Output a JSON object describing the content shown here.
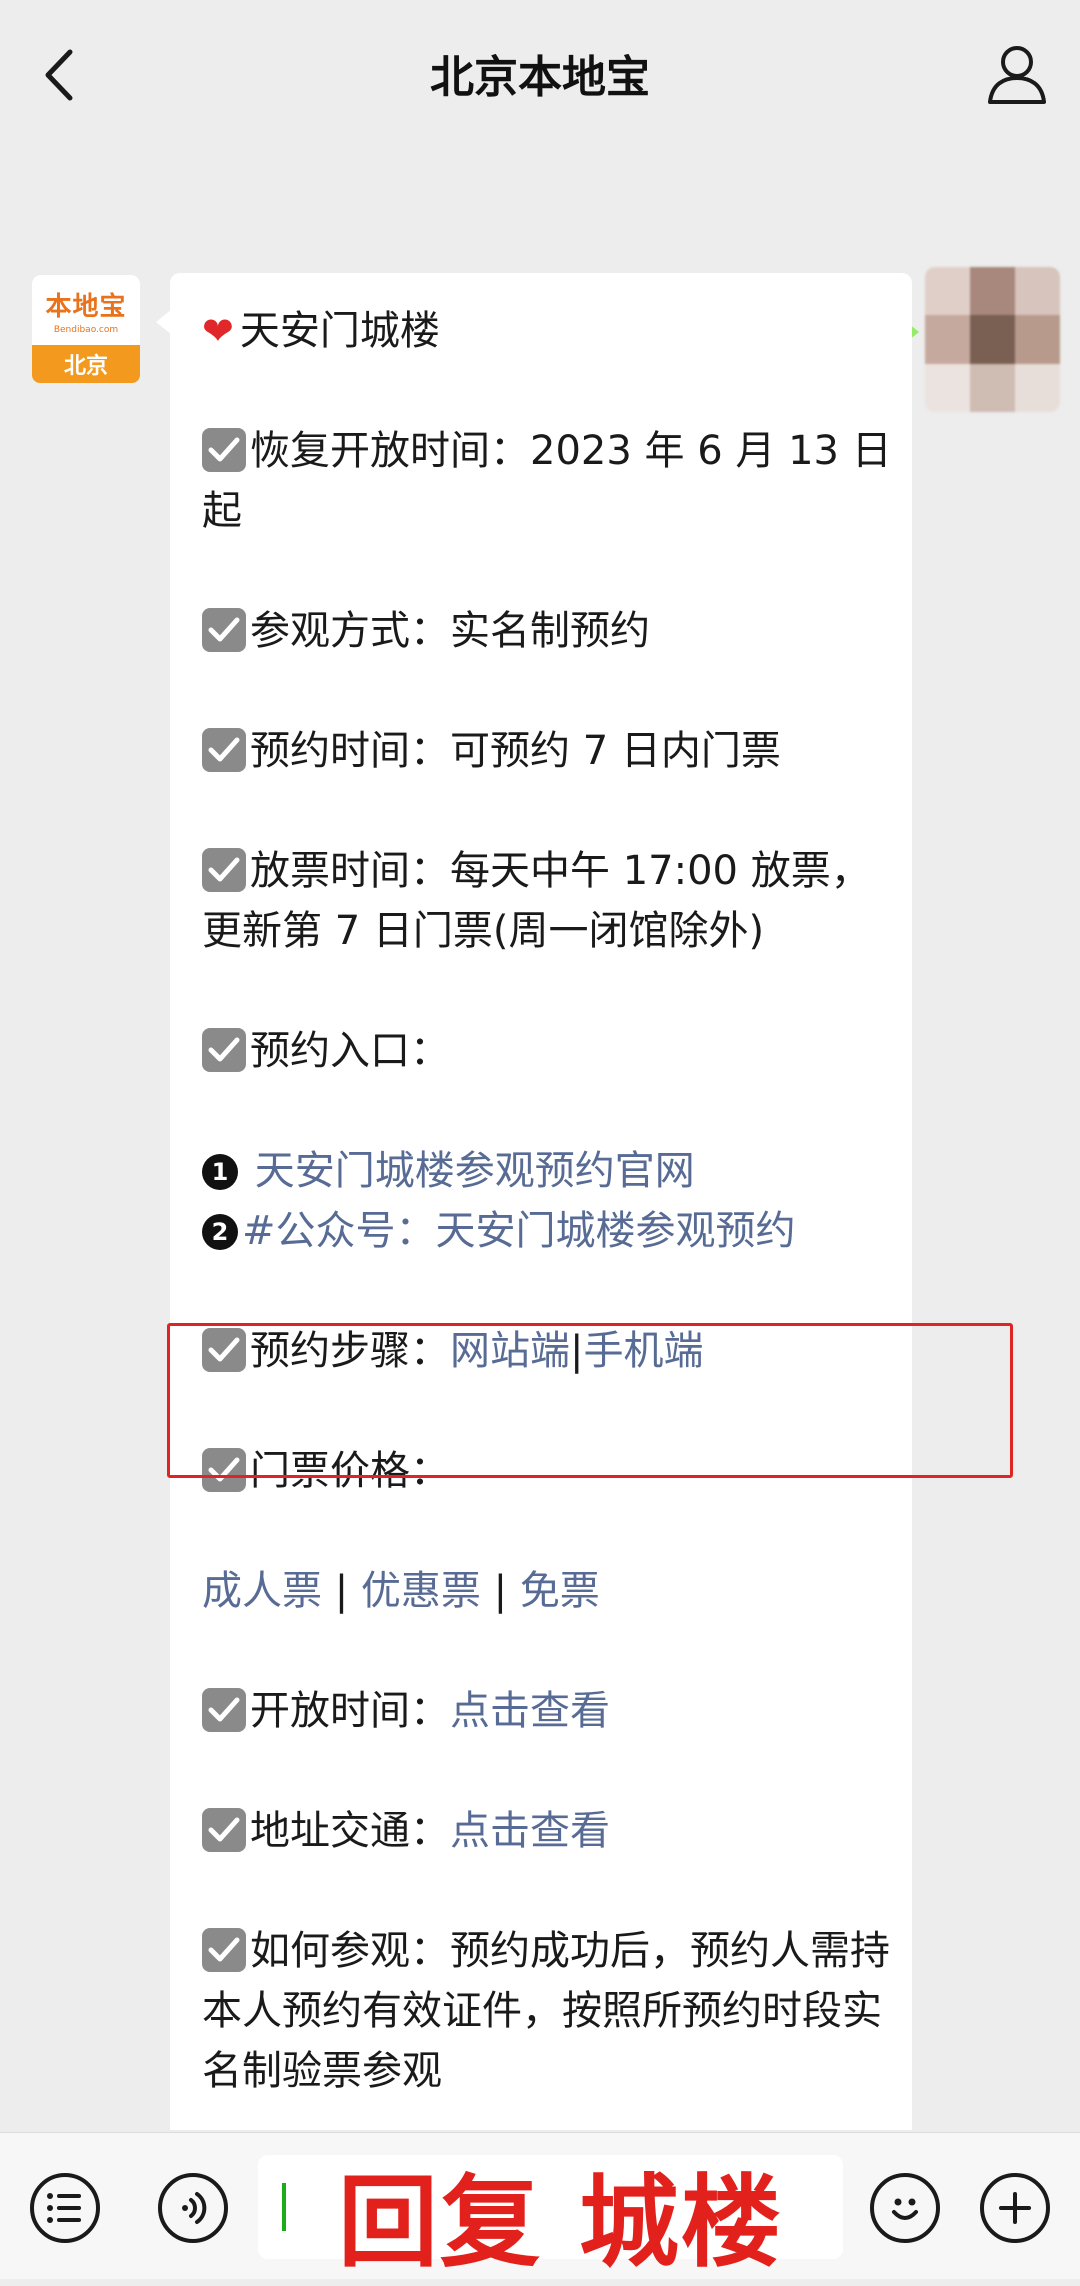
{
  "header": {
    "title": "北京本地宝"
  },
  "chat": {
    "sent_message": "城楼",
    "bot_avatar": {
      "brand": "本地宝",
      "domain": "Bendibao.com",
      "city": "北京"
    },
    "message": {
      "title": "天安门城楼",
      "reopen": "恢复开放时间：2023 年 6 月 13 日起",
      "visit_method": "参观方式：实名制预约",
      "booking_window": "预约时间：可预约 7 日内门票",
      "ticket_release": "放票时间：每天中午 17:00 放票，更新第 7 日门票(周一闭馆除外)",
      "entry_label": "预约入口：",
      "entry_link_1": "天安门城楼参观预约官网",
      "entry_2_prefix": "#公众号：",
      "entry_link_2": "天安门城楼参观预约",
      "steps_label": "预约步骤：",
      "steps_web": "网站端",
      "steps_sep": "|",
      "steps_mobile": "手机端",
      "price_label": "门票价格：",
      "price_adult": "成人票",
      "price_sep": " | ",
      "price_discount": "优惠票",
      "price_free": "免票",
      "hours_label": "开放时间：",
      "hours_link": "点击查看",
      "address_label": "地址交通：",
      "address_link": "点击查看",
      "how_to_visit": "如何参观：预约成功后，预约人需持本人预约有效证件，按照所预约时段实名制验票参观"
    }
  },
  "input_bar": {
    "input_text": "回复 城楼"
  },
  "icons": [
    "back-chevron-icon",
    "profile-icon",
    "heart-icon",
    "checkbox-icon",
    "list-menu-icon",
    "voice-icon",
    "emoji-icon",
    "plus-icon"
  ],
  "colors": {
    "background": "#ededed",
    "sent_bubble": "#95ec69",
    "link": "#576b95",
    "highlight": "#e02424",
    "brand": "#f39a1e"
  }
}
